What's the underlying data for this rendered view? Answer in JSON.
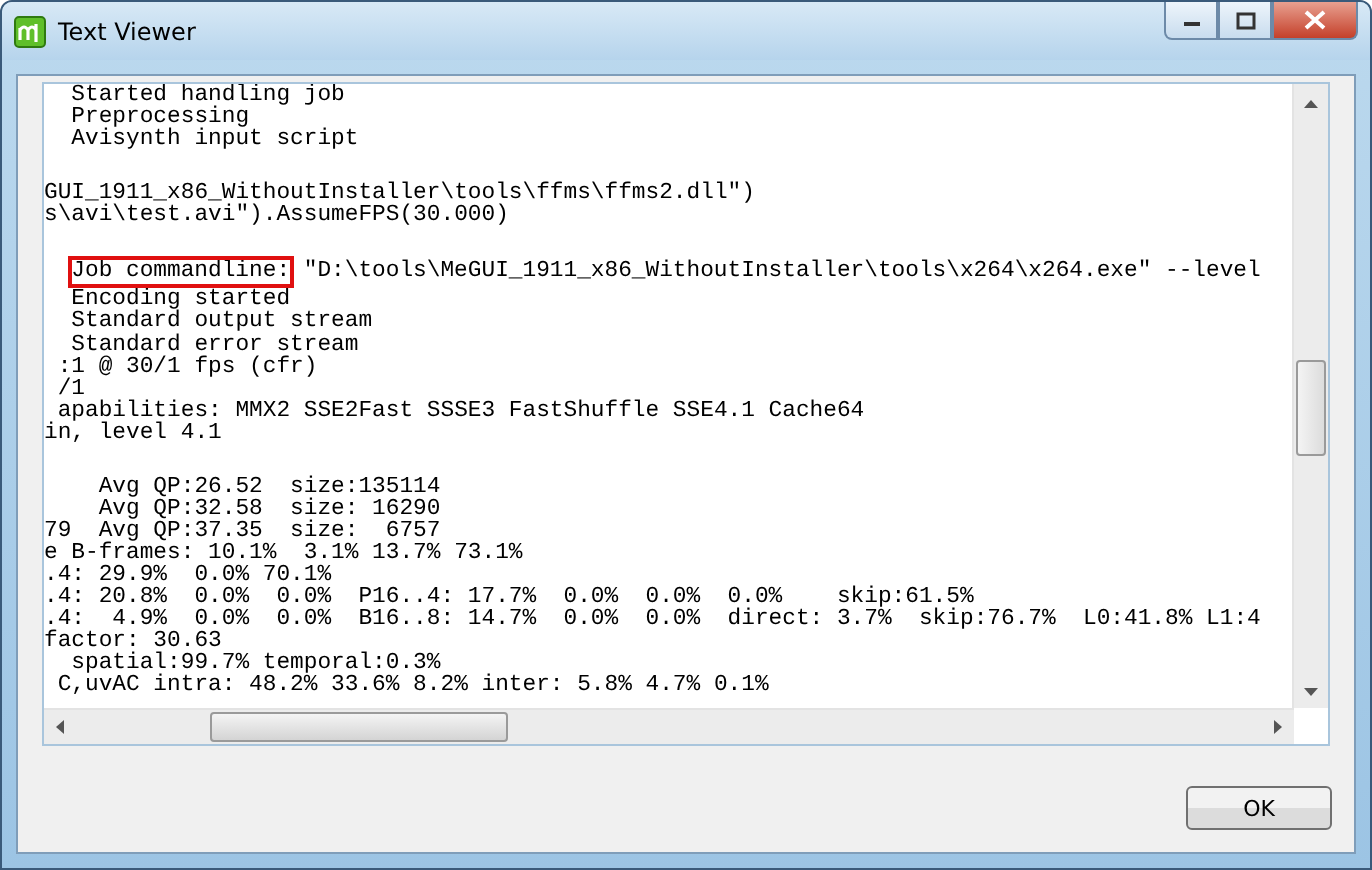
{
  "window": {
    "title": "Text Viewer"
  },
  "log_blocks": [
    {
      "lines": [
        {
          "text": "  Started handling job"
        },
        {
          "text": "  Preprocessing"
        },
        {
          "text": "  Avisynth input script"
        }
      ]
    },
    {
      "lines": [
        {
          "text": "GUI_1911_x86_WithoutInstaller\\tools\\ffms\\ffms2.dll\")"
        },
        {
          "text": "s\\avi\\test.avi\").AssumeFPS(30.000)"
        }
      ]
    },
    {
      "lines": [
        {
          "marked": "Job commandline:",
          "rest": " \"D:\\tools\\MeGUI_1911_x86_WithoutInstaller\\tools\\x264\\x264.exe\" --level"
        },
        {
          "text": "  Encoding started"
        },
        {
          "text": "  Standard output stream"
        },
        {
          "text": "  Standard error stream"
        },
        {
          "text": " :1 @ 30/1 fps (cfr)"
        },
        {
          "text": " /1"
        },
        {
          "text": " apabilities: MMX2 SSE2Fast SSSE3 FastShuffle SSE4.1 Cache64"
        },
        {
          "text": "in, level 4.1"
        }
      ]
    },
    {
      "lines": [
        {
          "text": "    Avg QP:26.52  size:135114"
        },
        {
          "text": "    Avg QP:32.58  size: 16290"
        },
        {
          "text": "79  Avg QP:37.35  size:  6757"
        },
        {
          "text": "e B-frames: 10.1%  3.1% 13.7% 73.1%"
        },
        {
          "text": ".4: 29.9%  0.0% 70.1%"
        },
        {
          "text": ".4: 20.8%  0.0%  0.0%  P16..4: 17.7%  0.0%  0.0%  0.0%    skip:61.5%"
        },
        {
          "text": ".4:  4.9%  0.0%  0.0%  B16..8: 14.7%  0.0%  0.0%  direct: 3.7%  skip:76.7%  L0:41.8% L1:4"
        },
        {
          "text": "factor: 30.63"
        },
        {
          "text": "  spatial:99.7% temporal:0.3%"
        },
        {
          "text": " C,uvAC intra: 48.2% 33.6% 8.2% inter: 5.8% 4.7% 0.1%"
        }
      ]
    }
  ],
  "buttons": [
    {
      "label": "OK"
    }
  ]
}
